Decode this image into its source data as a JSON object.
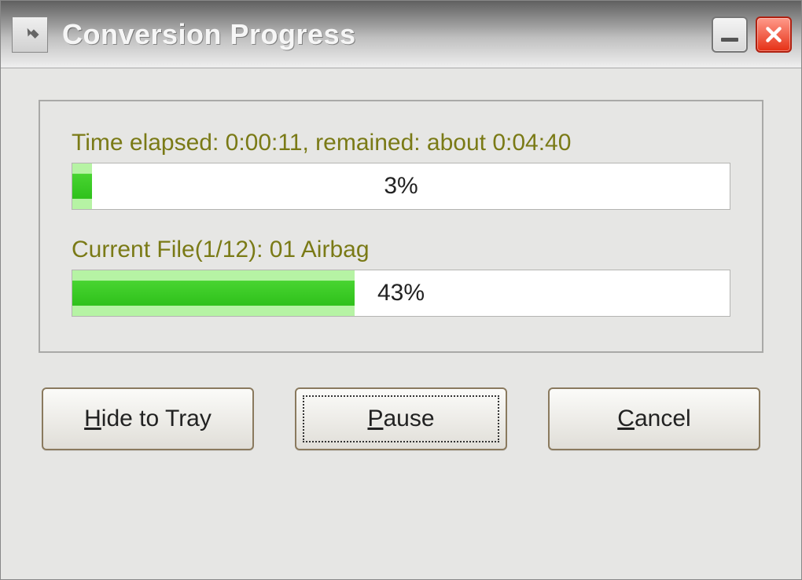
{
  "titlebar": {
    "title": "Conversion Progress"
  },
  "progress": {
    "time_label": "Time elapsed: 0:00:11, remained: about 0:04:40",
    "overall_percent_text": "3%",
    "overall_percent_width": "3%",
    "file_label": "Current File(1/12): 01 Airbag",
    "file_percent_text": "43%",
    "file_percent_width": "43%"
  },
  "buttons": {
    "hide_pre": "",
    "hide_u": "H",
    "hide_post": "ide to Tray",
    "pause_pre": "",
    "pause_u": "P",
    "pause_post": "ause",
    "cancel_pre": "",
    "cancel_u": "C",
    "cancel_post": "ancel"
  }
}
